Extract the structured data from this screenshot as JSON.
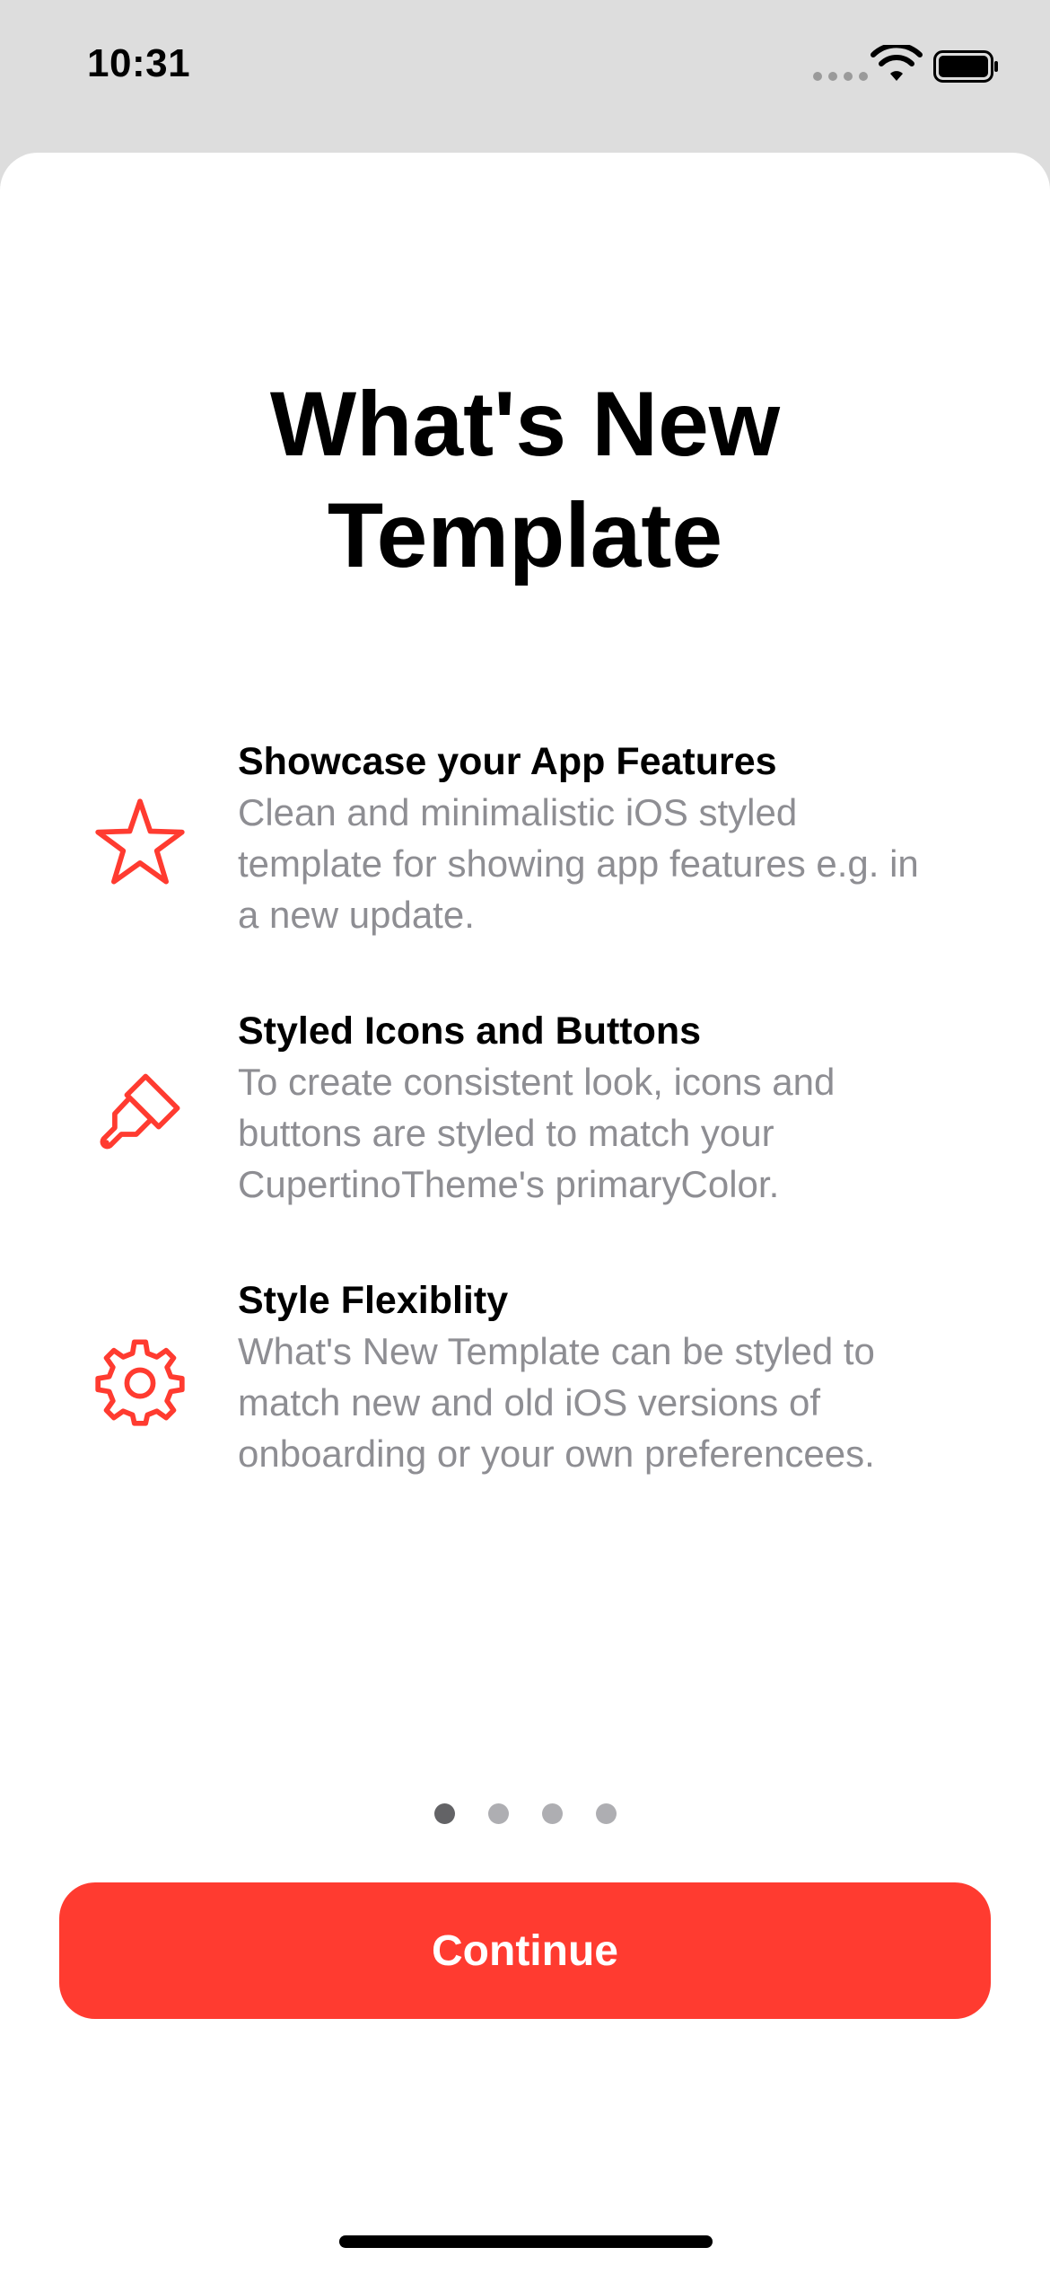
{
  "status_bar": {
    "time": "10:31",
    "icons": [
      "signal-dots-icon",
      "wifi-icon",
      "battery-icon"
    ]
  },
  "title_line1": "What's New",
  "title_line2": "Template",
  "features": [
    {
      "icon": "star-icon",
      "title": "Showcase your App Features",
      "description_lines": [
        "Clean and minimalistic iOS styled",
        "template for showing app features e.g. in",
        "a new update."
      ]
    },
    {
      "icon": "paintbrush-icon",
      "title": "Styled Icons and Buttons",
      "description_lines": [
        "To create consistent look, icons and",
        "buttons are styled to match your",
        "CupertinoTheme's primaryColor."
      ]
    },
    {
      "icon": "gear-icon",
      "title": "Style Flexiblity",
      "description_lines": [
        "What's New Template can be styled to",
        "match new and old iOS versions of",
        "onboarding or your own preferencees."
      ]
    }
  ],
  "pagination": {
    "total": 4,
    "current": 1
  },
  "continue_label": "Continue",
  "colors": {
    "accent": "#ff3b30",
    "background": "#dddddd",
    "sheet": "#ffffff",
    "secondary_text": "#8e8e93"
  }
}
